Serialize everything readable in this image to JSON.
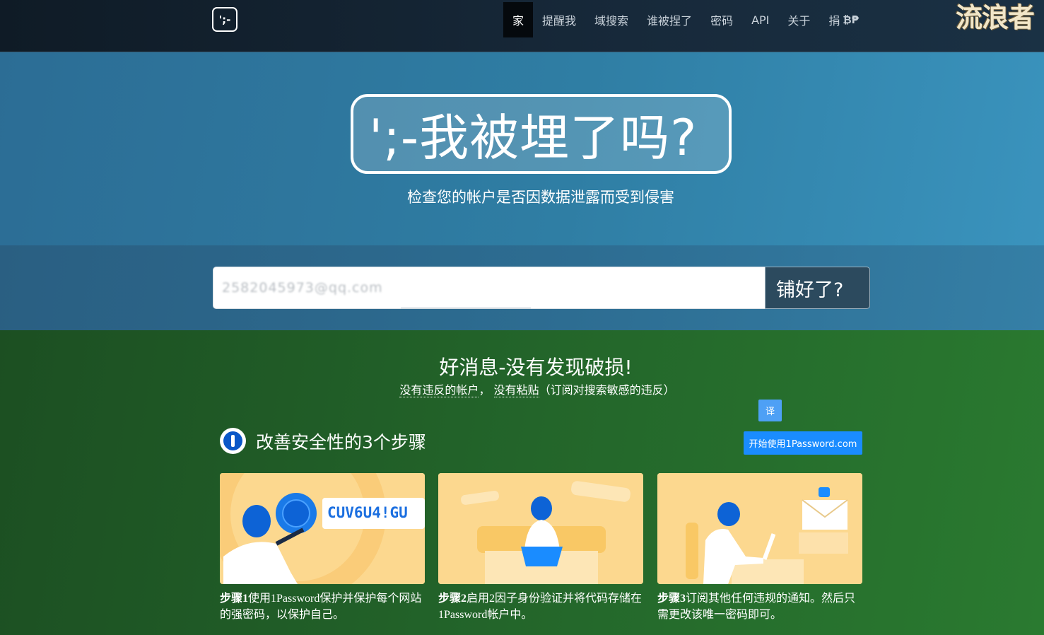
{
  "nav": {
    "brand": "';-",
    "items": [
      "家",
      "提醒我",
      "域搜索",
      "谁被捏了",
      "密码",
      "API",
      "关于"
    ],
    "donate": "捐",
    "donate_crypto": "₿₱",
    "watermark": "流浪者"
  },
  "hero": {
    "title": "';-我被埋了吗?",
    "subtitle": "检查您的帐户是否因数据泄露而受到侵害"
  },
  "search": {
    "value": "2582045973@qq.com",
    "button": "铺好了?"
  },
  "result": {
    "title": "好消息-没有发现破损!",
    "sub_a": "没有违反的帐户",
    "sub_sep": "，",
    "sub_b": "没有粘贴",
    "sub_c": "（订阅对搜索敏感的违反）",
    "translate": "译",
    "steps_title": "改善安全性的3个步骤",
    "onepassword_btn": "开始使用1Password.com",
    "step1_label": "步骤1",
    "step1_text": "使用1Password保护并保护每个网站的强密码，以保护自己。",
    "step1_password": "CUV6U4!GU",
    "step2_label": "步骤2",
    "step2_text": "启用2因子身份验证并将代码存储在1Password帐户中。",
    "step3_label": "步骤3",
    "step3_text": "订阅其他任何违规的通知。然后只需更改该唯一密码即可。"
  },
  "colors": {
    "hero": "#2f7ea4",
    "result": "#23652a",
    "button_blue": "#1a8cff",
    "card": "#fcd88f"
  }
}
